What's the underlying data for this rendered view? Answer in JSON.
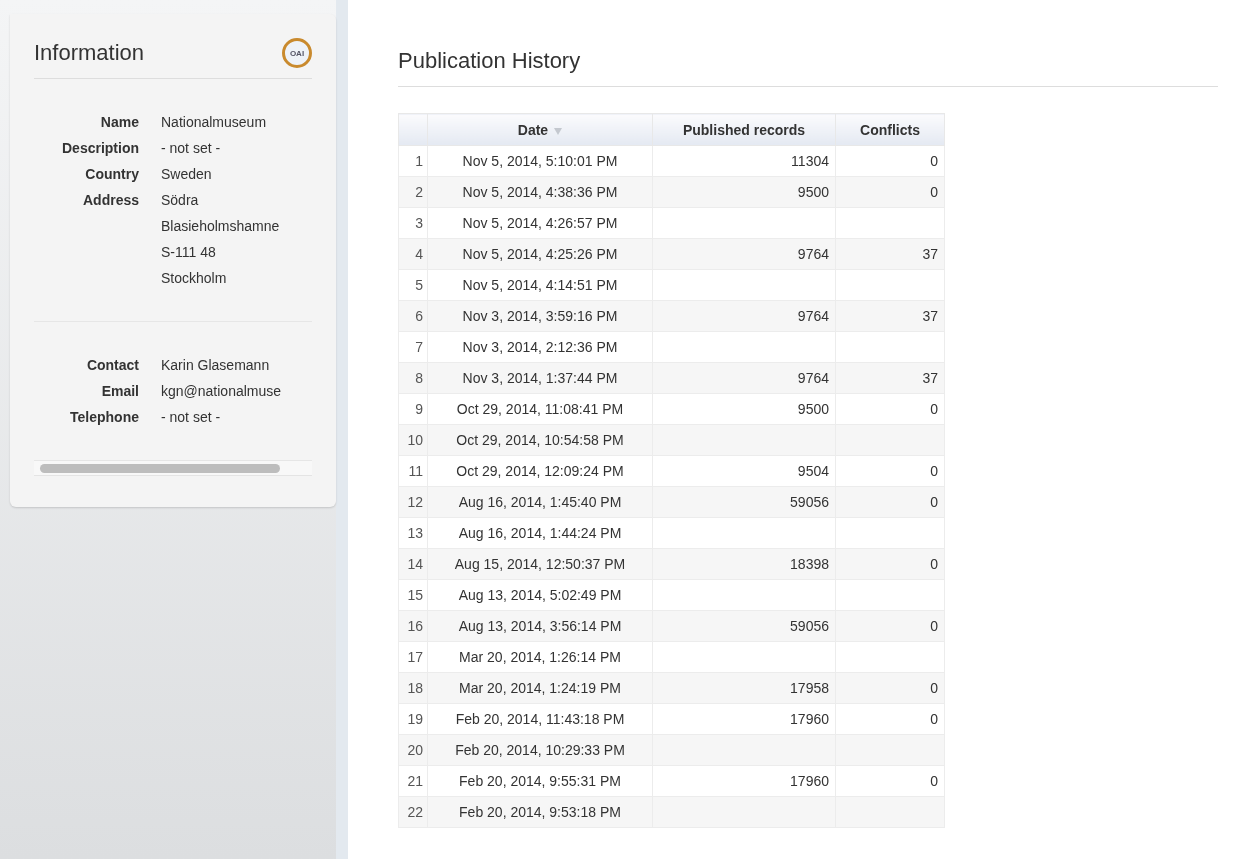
{
  "info": {
    "title": "Information",
    "badge": "OAI",
    "fields": [
      {
        "label": "Name",
        "lines": [
          "Nationalmuseum"
        ]
      },
      {
        "label": "Description",
        "lines": [
          "- not set -"
        ]
      },
      {
        "label": "Country",
        "lines": [
          "Sweden"
        ]
      },
      {
        "label": "Address",
        "lines": [
          "Södra",
          "Blasieholmshamne",
          "S-111 48",
          "Stockholm"
        ]
      }
    ],
    "contact_fields": [
      {
        "label": "Contact",
        "lines": [
          "Karin Glasemann"
        ]
      },
      {
        "label": "Email",
        "lines": [
          "kgn@nationalmuse"
        ]
      },
      {
        "label": "Telephone",
        "lines": [
          "- not set -"
        ]
      }
    ]
  },
  "history": {
    "title": "Publication History",
    "columns": [
      {
        "label": "Date",
        "sorted": true
      },
      {
        "label": "Published records",
        "sorted": false
      },
      {
        "label": "Conflicts",
        "sorted": false
      }
    ],
    "rows": [
      {
        "index": "1",
        "date": "Nov 5, 2014, 5:10:01 PM",
        "published": "11304",
        "conflicts": "0"
      },
      {
        "index": "2",
        "date": "Nov 5, 2014, 4:38:36 PM",
        "published": "9500",
        "conflicts": "0"
      },
      {
        "index": "3",
        "date": "Nov 5, 2014, 4:26:57 PM"
      },
      {
        "index": "4",
        "date": "Nov 5, 2014, 4:25:26 PM",
        "published": "9764",
        "conflicts": "37"
      },
      {
        "index": "5",
        "date": "Nov 5, 2014, 4:14:51 PM"
      },
      {
        "index": "6",
        "date": "Nov 3, 2014, 3:59:16 PM",
        "published": "9764",
        "conflicts": "37"
      },
      {
        "index": "7",
        "date": "Nov 3, 2014, 2:12:36 PM"
      },
      {
        "index": "8",
        "date": "Nov 3, 2014, 1:37:44 PM",
        "published": "9764",
        "conflicts": "37"
      },
      {
        "index": "9",
        "date": "Oct 29, 2014, 11:08:41 PM",
        "published": "9500",
        "conflicts": "0"
      },
      {
        "index": "10",
        "date": "Oct 29, 2014, 10:54:58 PM"
      },
      {
        "index": "11",
        "date": "Oct 29, 2014, 12:09:24 PM",
        "published": "9504",
        "conflicts": "0"
      },
      {
        "index": "12",
        "date": "Aug 16, 2014, 1:45:40 PM",
        "published": "59056",
        "conflicts": "0"
      },
      {
        "index": "13",
        "date": "Aug 16, 2014, 1:44:24 PM"
      },
      {
        "index": "14",
        "date": "Aug 15, 2014, 12:50:37 PM",
        "published": "18398",
        "conflicts": "0"
      },
      {
        "index": "15",
        "date": "Aug 13, 2014, 5:02:49 PM"
      },
      {
        "index": "16",
        "date": "Aug 13, 2014, 3:56:14 PM",
        "published": "59056",
        "conflicts": "0"
      },
      {
        "index": "17",
        "date": "Mar 20, 2014, 1:26:14 PM"
      },
      {
        "index": "18",
        "date": "Mar 20, 2014, 1:24:19 PM",
        "published": "17958",
        "conflicts": "0"
      },
      {
        "index": "19",
        "date": "Feb 20, 2014, 11:43:18 PM",
        "published": "17960",
        "conflicts": "0"
      },
      {
        "index": "20",
        "date": "Feb 20, 2014, 10:29:33 PM"
      },
      {
        "index": "21",
        "date": "Feb 20, 2014, 9:55:31 PM",
        "published": "17960",
        "conflicts": "0"
      },
      {
        "index": "22",
        "date": "Feb 20, 2014, 9:53:18 PM"
      }
    ]
  }
}
